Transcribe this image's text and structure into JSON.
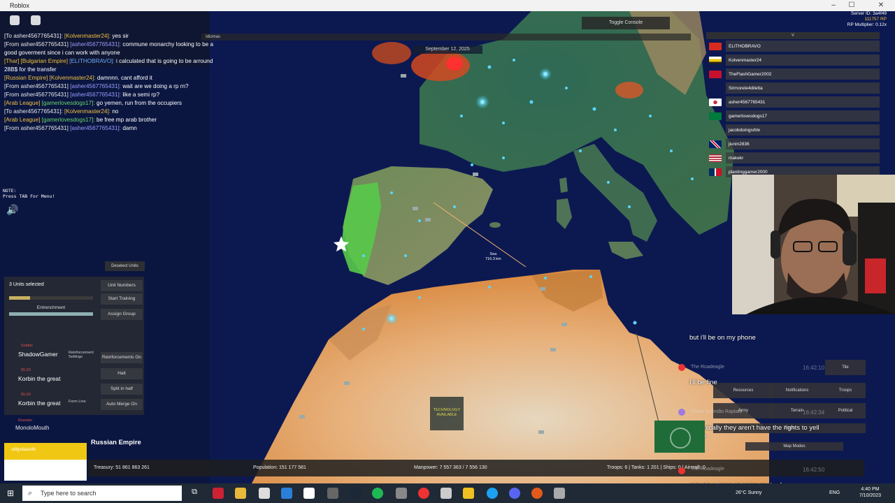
{
  "window": {
    "title": "Roblox"
  },
  "server_info": {
    "line1": "Server ID: 3a4f49",
    "line2": "111757 RP",
    "line3": "RP Multiplier: 0.12x"
  },
  "chat": [
    {
      "a": "[To asher4567765431]:",
      "b": "[Kolvenmaster24]:",
      "m": "yes sir"
    },
    {
      "a": "[From asher4567765431]",
      "b": "[asher4567765431]:",
      "m": "commune monarchy looking to be a"
    },
    {
      "a": "",
      "b": "",
      "m": "good goverment since i can work with anyone"
    },
    {
      "a": "[Thar] [Bulgarian Empire]",
      "b": "[ELITHOBRAVO]:",
      "m": "i calculated that is going to be arround"
    },
    {
      "a": "",
      "b": "",
      "m": "28B$ for the transfer"
    },
    {
      "a": "[Russian Empire]",
      "b": "[Kolvenmaster24]:",
      "m": "damnnn. cant afford it"
    },
    {
      "a": "[From asher4567765431]",
      "b": "[asher4567765431]:",
      "m": "wait are we doing a rp rn?"
    },
    {
      "a": "[From asher4567765431]",
      "b": "[asher4567765431]:",
      "m": "like a semi rp?"
    },
    {
      "a": "[Arab League]",
      "b": "[gamerlovesdogs17]:",
      "m": "go yemen, run from the occupiers"
    },
    {
      "a": "[To asher4567765431]:",
      "b": "[Kolvenmaster24]:",
      "m": "no"
    },
    {
      "a": "[Arab League]",
      "b": "[gamerlovesdogs17]:",
      "m": "be free mp arab brother"
    },
    {
      "a": "[From asher4567765431]",
      "b": "[asher4567765431]:",
      "m": "damn"
    }
  ],
  "top": {
    "toggle_console": "Toggle Console",
    "date": "September 12, 2025",
    "strip": "Idiomas"
  },
  "players": {
    "header": "V",
    "rows": [
      {
        "name": "ELITHOBRAVO",
        "c1": "#d52b1e",
        "c2": "#f0c040"
      },
      {
        "name": "Kolvenmaster24",
        "c1": "#ffffff",
        "c2": "#f0c814"
      },
      {
        "name": "TheFlashGamer2002",
        "c1": "#c8102e",
        "c2": "#ffffff"
      },
      {
        "name": "Sirmorele4diletta",
        "c1": "#333333",
        "c2": "#333333"
      },
      {
        "name": "asher4567765431",
        "c1": "#ffffff",
        "c2": "#cd2e3a"
      },
      {
        "name": "gamerlovesdogs17",
        "c1": "#007a3d",
        "c2": "#ffffff"
      },
      {
        "name": "jacobdoingsrblx",
        "c1": "#333333",
        "c2": "#333333"
      },
      {
        "name": "jiunin2836",
        "c1": "#012169",
        "c2": "#c8102e"
      },
      {
        "name": "makekr",
        "c1": "#3c3b6e",
        "c2": "#b22234"
      },
      {
        "name": "plantinggamer2000",
        "c1": "#002d62",
        "c2": "#ce1126"
      }
    ]
  },
  "note": {
    "l1": "NOTE:",
    "l2": "Press TAB For Menu!"
  },
  "unit_panel": {
    "deselect": "Deselect Units",
    "title": "3 Units selected",
    "entrenchment": "Entrenchment",
    "buttons": [
      "Unit Numbers",
      "Start Training",
      "Assign Group",
      "Reinforcements On",
      "Halt",
      "Split in half",
      "Auto Merge On"
    ],
    "units": [
      {
        "tag": "Soldier",
        "name": "ShadowGamer",
        "sub": "Reinforcement Settings"
      },
      {
        "tag": "55.00",
        "name": "Korbin the great",
        "sub": ""
      },
      {
        "tag": "55.00",
        "name": "Korbin the great",
        "sub": "Form Line"
      }
    ],
    "extra_unit": {
      "tag": "Russian",
      "name": "MonoloMouth"
    }
  },
  "nation": {
    "name": "Russian Empire",
    "yellow_label": "sdfgsdaasdfs"
  },
  "stats": {
    "treasury": "Treasury:  51 861 863 261",
    "population": "Population: 151 177 581",
    "manpower": "Manpower: 7 557 363  /  7 556 130",
    "troops": "Troops: 6  |  Tanks: 1 201  |  Ships: 0  |  Aircraft: 0"
  },
  "map": {
    "tech_badge": "TECHNOLOGY AVAILABLE",
    "distance_label": "Sea",
    "distance_value": "716.3 km"
  },
  "right_menu": {
    "buttons": [
      "Tile",
      "Resources",
      "Notifications",
      "Troops",
      "Army",
      "Terrain",
      "Political",
      "Trade",
      "Map Modes"
    ]
  },
  "live_chat": [
    {
      "user": "",
      "msg": "but i'll be on my phone",
      "time": ""
    },
    {
      "user": "The Roadeagle",
      "msg": "",
      "time": "16:42:10"
    },
    {
      "user": "",
      "msg": "I'll be fine",
      "time": ""
    },
    {
      "user": "Ghost Incendio Raptalo",
      "msg": "",
      "time": "16:42:34"
    },
    {
      "user": "",
      "msg": "Technically they aren't have the rights to yell at me",
      "time": ""
    },
    {
      "user": "The Roadeagle",
      "msg": "",
      "time": "16:42:50"
    },
    {
      "user": "",
      "msg": "why do u keep refusing my trade",
      "time": ""
    }
  ],
  "taskbar": {
    "search_placeholder": "Type here to search",
    "weather": "26°C  Sunny",
    "lang": "ENG",
    "time": "4:40 PM",
    "date": "7/10/2023"
  }
}
